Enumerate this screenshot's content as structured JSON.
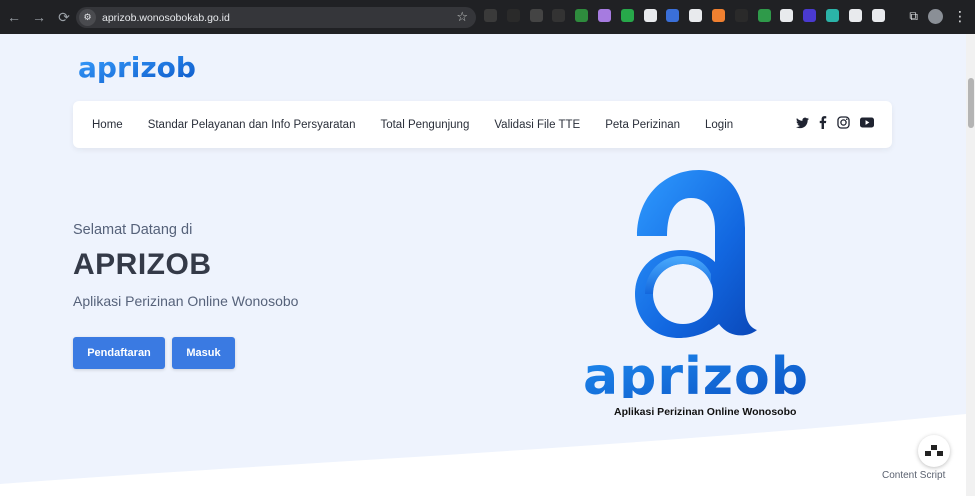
{
  "browser": {
    "url": "aprizob.wonosobokab.go.id",
    "extension_colors": [
      "#3a3a3a",
      "#2a2a2a",
      "#444",
      "#333",
      "#2e8b3d",
      "#a67be0",
      "#27a84a",
      "#e8eaed",
      "#3a6fd8",
      "#e8eaed",
      "#f08030",
      "#2a2a2a",
      "#2f9a4a",
      "#e8eaed",
      "#4a3ad0",
      "#2bb3a8",
      "#e8eaed",
      "#e8eaed"
    ]
  },
  "page": {
    "logo_text": "aprizob",
    "nav": {
      "items": [
        {
          "label": "Home"
        },
        {
          "label": "Standar Pelayanan dan Info Persyaratan"
        },
        {
          "label": "Total Pengunjung"
        },
        {
          "label": "Validasi File TTE"
        },
        {
          "label": "Peta Perizinan"
        },
        {
          "label": "Login"
        }
      ],
      "social": [
        "twitter-icon",
        "facebook-icon",
        "instagram-icon",
        "youtube-icon"
      ]
    },
    "hero": {
      "welcome": "Selamat Datang di",
      "title": "APRIZOB",
      "subtitle": "Aplikasi Perizinan Online Wonosobo",
      "buttons": {
        "register": "Pendaftaran",
        "login": "Masuk"
      }
    },
    "big_logo": {
      "word": "aprizob",
      "tagline": "Aplikasi Perizinan Online Wonosobo"
    },
    "floating": {
      "label": "Content Script"
    },
    "colors": {
      "accent": "#3a7ae2",
      "page_bg": "#eef3fd",
      "logo_blue": "#1e7fe6",
      "logo_dark": "#0f55c9"
    }
  }
}
